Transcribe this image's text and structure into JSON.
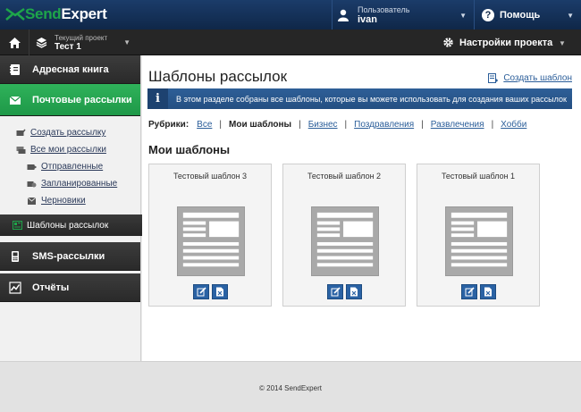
{
  "header": {
    "logo_text_a": "Send",
    "logo_text_b": "Expert",
    "user_label": "Пользователь",
    "user_name": "ivan",
    "help_label": "Помощь"
  },
  "project_bar": {
    "project_label": "Текущий проект",
    "project_name": "Тест 1",
    "settings_label": "Настройки проекта"
  },
  "sidebar": {
    "address_book": "Адресная книга",
    "mailings": "Почтовые рассылки",
    "create_mailing": "Создать рассылку",
    "all_mailings": "Все мои рассылки",
    "sent": "Отправленные",
    "scheduled": "Запланированные",
    "drafts": "Черновики",
    "templates": "Шаблоны рассылок",
    "sms": "SMS-рассылки",
    "reports": "Отчёты"
  },
  "main": {
    "title": "Шаблоны рассылок",
    "create_template": "Создать шаблон",
    "info_text": "В этом разделе собраны все шаблоны, которые вы можете использовать для создания ваших рассылок",
    "categories_label": "Рубрики:",
    "categories": [
      "Все",
      "Мои шаблоны",
      "Бизнес",
      "Поздравления",
      "Развлечения",
      "Хобби"
    ],
    "section_title": "Мои шаблоны",
    "templates": [
      {
        "title": "Тестовый шаблон 3"
      },
      {
        "title": "Тестовый шаблон 2"
      },
      {
        "title": "Тестовый шаблон 1"
      }
    ]
  },
  "footer": {
    "copyright": "© 2014 SendExpert"
  },
  "colors": {
    "brand_green": "#1ea54a",
    "header_blue": "#0f2748",
    "info_blue": "#2e5f97",
    "link_blue": "#2a5d99"
  }
}
